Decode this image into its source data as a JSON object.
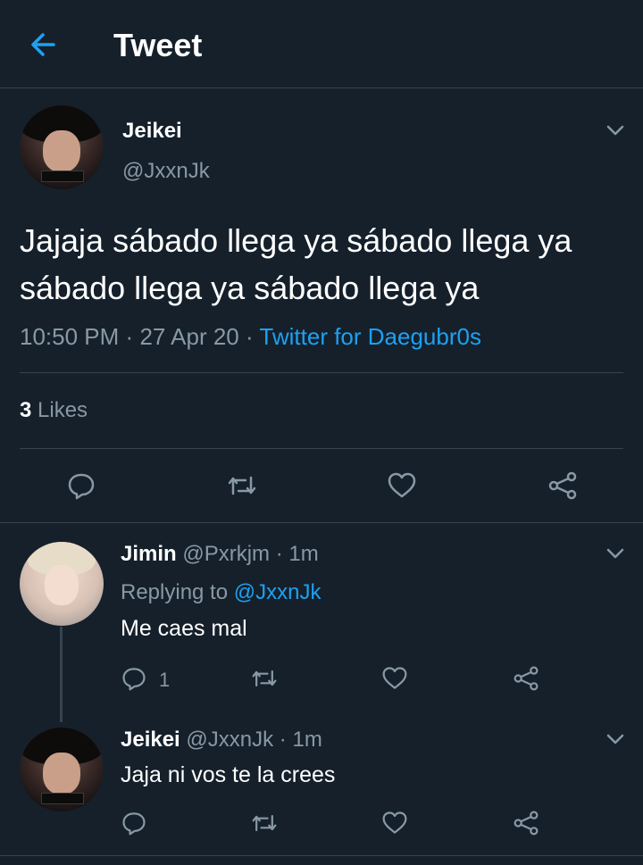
{
  "header": {
    "title": "Tweet"
  },
  "tweet": {
    "name": "Jeikei",
    "handle": "@JxxnJk",
    "text": "Jajaja sábado llega ya sábado llega ya sábado llega ya sábado llega ya",
    "time": "10:50 PM",
    "date": "27 Apr 20",
    "separator": "·",
    "source": "Twitter for Daegubr0s",
    "likes_count": "3",
    "likes_label": "Likes"
  },
  "replies": [
    {
      "name": "Jimin",
      "handle": "@Pxrkjm",
      "separator": "·",
      "time": "1m",
      "replying_label": "Replying to",
      "replying_to": "@JxxnJk",
      "text": "Me caes mal",
      "reply_count": "1"
    },
    {
      "name": "Jeikei",
      "handle": "@JxxnJk",
      "separator": "·",
      "time": "1m",
      "text": "Jaja ni vos te la crees"
    }
  ],
  "icons": {
    "back": "arrow-left-icon",
    "more": "chevron-down-icon",
    "reply": "reply-icon",
    "retweet": "retweet-icon",
    "like": "heart-icon",
    "share": "share-icon"
  },
  "colors": {
    "background": "#15202b",
    "accent": "#1da1f2",
    "secondary_text": "#8899a6",
    "divider": "#38444d"
  }
}
